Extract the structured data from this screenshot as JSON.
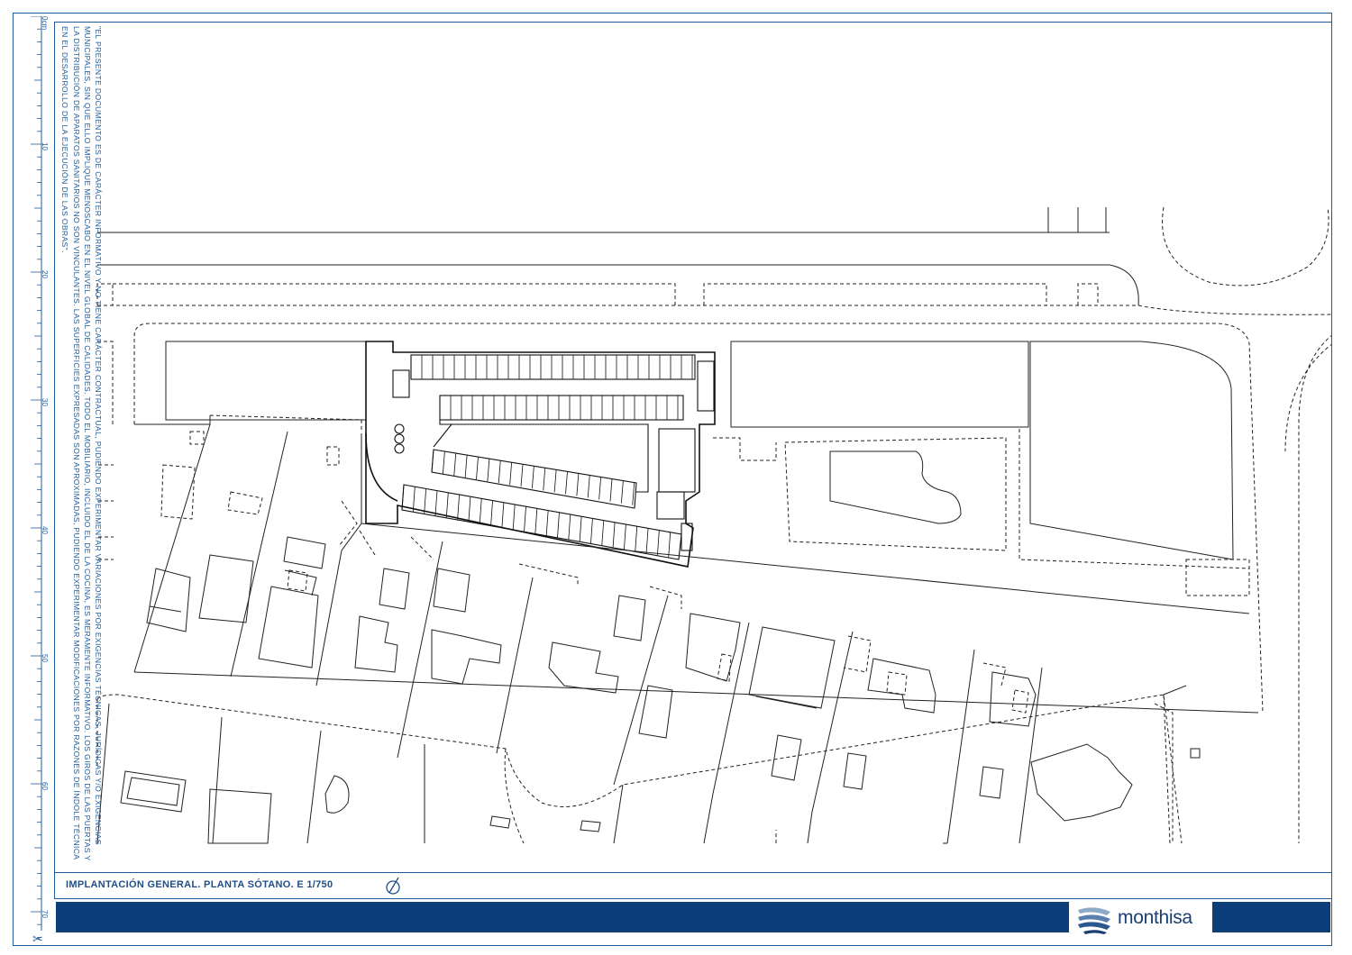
{
  "sheet": {
    "disclaimer": "\"El presente documento es de carácter informativo y no tiene carácter contractual, pudiendo experimentar variaciones por exigencias técnicas, jurídicas y/o exigencias municipales, sin que ello implique menoscabo en el nivel global de calidades. Todo el mobiliario, incluido el de la cocina, es meramente informativo. Los giros de las puertas y la distribución de aparatos sanitarios no son vinculantes. Las superficies expresadas son aproximadas, pudiendo experimentar modificaciones por razones de índole técnica en el desarrollo de la ejecución de las obras\".",
    "title": "IMPLANTACIÓN GENERAL. PLANTA SÓTANO. E 1/750",
    "brand": "monthisa",
    "north_icon": "north-arrow-icon"
  },
  "ruler": {
    "labels": [
      "0cm",
      "10",
      "20",
      "30",
      "40",
      "50",
      "60",
      "70"
    ],
    "cut_icon": "scissors-icon"
  },
  "colors": {
    "frame": "#1f5b9a",
    "band": "#0d3e7a",
    "brand_text": "#1b3f73",
    "plan_lines": "#222222"
  }
}
